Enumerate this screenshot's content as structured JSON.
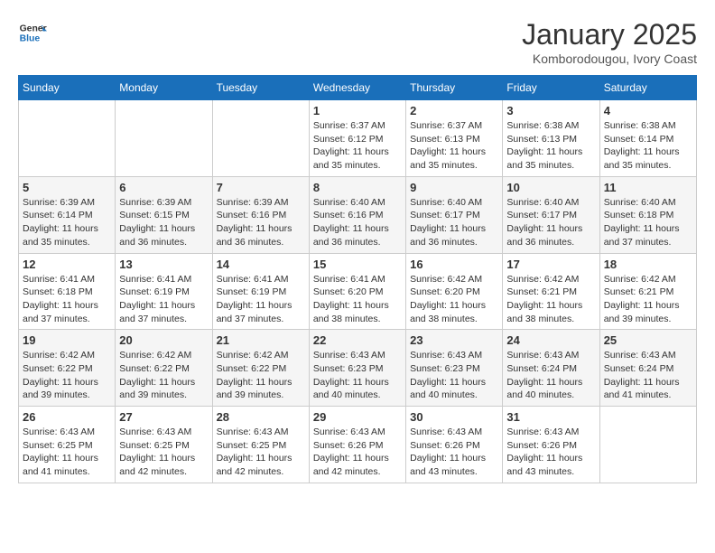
{
  "header": {
    "logo": {
      "text_general": "General",
      "text_blue": "Blue"
    },
    "title": "January 2025",
    "location": "Komborodougou, Ivory Coast"
  },
  "weekdays": [
    "Sunday",
    "Monday",
    "Tuesday",
    "Wednesday",
    "Thursday",
    "Friday",
    "Saturday"
  ],
  "weeks": [
    [
      {
        "day": "",
        "sunrise": "",
        "sunset": "",
        "daylight": ""
      },
      {
        "day": "",
        "sunrise": "",
        "sunset": "",
        "daylight": ""
      },
      {
        "day": "",
        "sunrise": "",
        "sunset": "",
        "daylight": ""
      },
      {
        "day": "1",
        "sunrise": "Sunrise: 6:37 AM",
        "sunset": "Sunset: 6:12 PM",
        "daylight": "Daylight: 11 hours and 35 minutes."
      },
      {
        "day": "2",
        "sunrise": "Sunrise: 6:37 AM",
        "sunset": "Sunset: 6:13 PM",
        "daylight": "Daylight: 11 hours and 35 minutes."
      },
      {
        "day": "3",
        "sunrise": "Sunrise: 6:38 AM",
        "sunset": "Sunset: 6:13 PM",
        "daylight": "Daylight: 11 hours and 35 minutes."
      },
      {
        "day": "4",
        "sunrise": "Sunrise: 6:38 AM",
        "sunset": "Sunset: 6:14 PM",
        "daylight": "Daylight: 11 hours and 35 minutes."
      }
    ],
    [
      {
        "day": "5",
        "sunrise": "Sunrise: 6:39 AM",
        "sunset": "Sunset: 6:14 PM",
        "daylight": "Daylight: 11 hours and 35 minutes."
      },
      {
        "day": "6",
        "sunrise": "Sunrise: 6:39 AM",
        "sunset": "Sunset: 6:15 PM",
        "daylight": "Daylight: 11 hours and 36 minutes."
      },
      {
        "day": "7",
        "sunrise": "Sunrise: 6:39 AM",
        "sunset": "Sunset: 6:16 PM",
        "daylight": "Daylight: 11 hours and 36 minutes."
      },
      {
        "day": "8",
        "sunrise": "Sunrise: 6:40 AM",
        "sunset": "Sunset: 6:16 PM",
        "daylight": "Daylight: 11 hours and 36 minutes."
      },
      {
        "day": "9",
        "sunrise": "Sunrise: 6:40 AM",
        "sunset": "Sunset: 6:17 PM",
        "daylight": "Daylight: 11 hours and 36 minutes."
      },
      {
        "day": "10",
        "sunrise": "Sunrise: 6:40 AM",
        "sunset": "Sunset: 6:17 PM",
        "daylight": "Daylight: 11 hours and 36 minutes."
      },
      {
        "day": "11",
        "sunrise": "Sunrise: 6:40 AM",
        "sunset": "Sunset: 6:18 PM",
        "daylight": "Daylight: 11 hours and 37 minutes."
      }
    ],
    [
      {
        "day": "12",
        "sunrise": "Sunrise: 6:41 AM",
        "sunset": "Sunset: 6:18 PM",
        "daylight": "Daylight: 11 hours and 37 minutes."
      },
      {
        "day": "13",
        "sunrise": "Sunrise: 6:41 AM",
        "sunset": "Sunset: 6:19 PM",
        "daylight": "Daylight: 11 hours and 37 minutes."
      },
      {
        "day": "14",
        "sunrise": "Sunrise: 6:41 AM",
        "sunset": "Sunset: 6:19 PM",
        "daylight": "Daylight: 11 hours and 37 minutes."
      },
      {
        "day": "15",
        "sunrise": "Sunrise: 6:41 AM",
        "sunset": "Sunset: 6:20 PM",
        "daylight": "Daylight: 11 hours and 38 minutes."
      },
      {
        "day": "16",
        "sunrise": "Sunrise: 6:42 AM",
        "sunset": "Sunset: 6:20 PM",
        "daylight": "Daylight: 11 hours and 38 minutes."
      },
      {
        "day": "17",
        "sunrise": "Sunrise: 6:42 AM",
        "sunset": "Sunset: 6:21 PM",
        "daylight": "Daylight: 11 hours and 38 minutes."
      },
      {
        "day": "18",
        "sunrise": "Sunrise: 6:42 AM",
        "sunset": "Sunset: 6:21 PM",
        "daylight": "Daylight: 11 hours and 39 minutes."
      }
    ],
    [
      {
        "day": "19",
        "sunrise": "Sunrise: 6:42 AM",
        "sunset": "Sunset: 6:22 PM",
        "daylight": "Daylight: 11 hours and 39 minutes."
      },
      {
        "day": "20",
        "sunrise": "Sunrise: 6:42 AM",
        "sunset": "Sunset: 6:22 PM",
        "daylight": "Daylight: 11 hours and 39 minutes."
      },
      {
        "day": "21",
        "sunrise": "Sunrise: 6:42 AM",
        "sunset": "Sunset: 6:22 PM",
        "daylight": "Daylight: 11 hours and 39 minutes."
      },
      {
        "day": "22",
        "sunrise": "Sunrise: 6:43 AM",
        "sunset": "Sunset: 6:23 PM",
        "daylight": "Daylight: 11 hours and 40 minutes."
      },
      {
        "day": "23",
        "sunrise": "Sunrise: 6:43 AM",
        "sunset": "Sunset: 6:23 PM",
        "daylight": "Daylight: 11 hours and 40 minutes."
      },
      {
        "day": "24",
        "sunrise": "Sunrise: 6:43 AM",
        "sunset": "Sunset: 6:24 PM",
        "daylight": "Daylight: 11 hours and 40 minutes."
      },
      {
        "day": "25",
        "sunrise": "Sunrise: 6:43 AM",
        "sunset": "Sunset: 6:24 PM",
        "daylight": "Daylight: 11 hours and 41 minutes."
      }
    ],
    [
      {
        "day": "26",
        "sunrise": "Sunrise: 6:43 AM",
        "sunset": "Sunset: 6:25 PM",
        "daylight": "Daylight: 11 hours and 41 minutes."
      },
      {
        "day": "27",
        "sunrise": "Sunrise: 6:43 AM",
        "sunset": "Sunset: 6:25 PM",
        "daylight": "Daylight: 11 hours and 42 minutes."
      },
      {
        "day": "28",
        "sunrise": "Sunrise: 6:43 AM",
        "sunset": "Sunset: 6:25 PM",
        "daylight": "Daylight: 11 hours and 42 minutes."
      },
      {
        "day": "29",
        "sunrise": "Sunrise: 6:43 AM",
        "sunset": "Sunset: 6:26 PM",
        "daylight": "Daylight: 11 hours and 42 minutes."
      },
      {
        "day": "30",
        "sunrise": "Sunrise: 6:43 AM",
        "sunset": "Sunset: 6:26 PM",
        "daylight": "Daylight: 11 hours and 43 minutes."
      },
      {
        "day": "31",
        "sunrise": "Sunrise: 6:43 AM",
        "sunset": "Sunset: 6:26 PM",
        "daylight": "Daylight: 11 hours and 43 minutes."
      },
      {
        "day": "",
        "sunrise": "",
        "sunset": "",
        "daylight": ""
      }
    ]
  ]
}
